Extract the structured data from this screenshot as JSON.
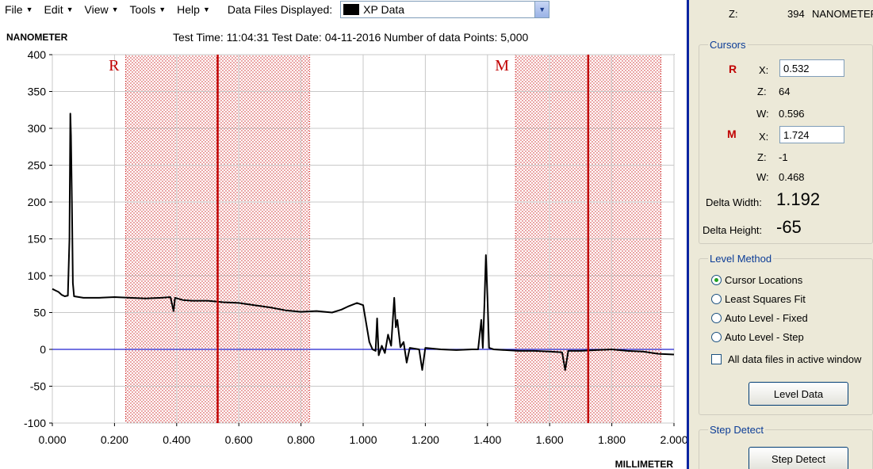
{
  "menu": {
    "items": [
      {
        "label": "File"
      },
      {
        "label": "Edit"
      },
      {
        "label": "View"
      },
      {
        "label": "Tools"
      },
      {
        "label": "Help"
      }
    ],
    "files_label": "Data Files Displayed:",
    "files_value": "XP Data"
  },
  "chart": {
    "y_unit": "NANOMETER",
    "x_unit": "MILLIMETER",
    "info": "Test Time: 11:04:31  Test Date: 04-11-2016  Number of data Points: 5,000"
  },
  "chart_data": {
    "type": "line",
    "x_range": [
      0,
      2.0
    ],
    "y_range": [
      -100,
      400
    ],
    "x_ticks": [
      {
        "value": 0.0,
        "label": "0.000"
      },
      {
        "value": 0.2,
        "label": "0.200"
      },
      {
        "value": 0.4,
        "label": "0.400"
      },
      {
        "value": 0.6,
        "label": "0.600"
      },
      {
        "value": 0.8,
        "label": "0.800"
      },
      {
        "value": 1.0,
        "label": "1.000"
      },
      {
        "value": 1.2,
        "label": "1.200"
      },
      {
        "value": 1.4,
        "label": "1.400"
      },
      {
        "value": 1.6,
        "label": "1.600"
      },
      {
        "value": 1.8,
        "label": "1.800"
      },
      {
        "value": 2.0,
        "label": "2.000"
      }
    ],
    "y_ticks": [
      {
        "value": 400,
        "label": "400"
      },
      {
        "value": 350,
        "label": "350"
      },
      {
        "value": 300,
        "label": "300"
      },
      {
        "value": 250,
        "label": "250"
      },
      {
        "value": 200,
        "label": "200"
      },
      {
        "value": 150,
        "label": "150"
      },
      {
        "value": 100,
        "label": "100"
      },
      {
        "value": 50,
        "label": "50"
      },
      {
        "value": 0,
        "label": "0"
      },
      {
        "value": -50,
        "label": "-50"
      },
      {
        "value": -100,
        "label": "-100"
      }
    ],
    "grid": true,
    "baseline": 0,
    "cursors": [
      {
        "label": "R",
        "x": 0.532,
        "band": [
          0.236,
          0.828
        ]
      },
      {
        "label": "M",
        "x": 1.724,
        "band": [
          1.49,
          1.958
        ]
      }
    ],
    "profile": [
      [
        0.0,
        82
      ],
      [
        0.01,
        80
      ],
      [
        0.02,
        78
      ],
      [
        0.03,
        74
      ],
      [
        0.04,
        72
      ],
      [
        0.05,
        73
      ],
      [
        0.055,
        150
      ],
      [
        0.058,
        320
      ],
      [
        0.06,
        290
      ],
      [
        0.063,
        200
      ],
      [
        0.066,
        90
      ],
      [
        0.07,
        72
      ],
      [
        0.1,
        70
      ],
      [
        0.15,
        70
      ],
      [
        0.2,
        71
      ],
      [
        0.25,
        70
      ],
      [
        0.3,
        69
      ],
      [
        0.35,
        70
      ],
      [
        0.38,
        71
      ],
      [
        0.39,
        52
      ],
      [
        0.395,
        70
      ],
      [
        0.42,
        67
      ],
      [
        0.45,
        66
      ],
      [
        0.5,
        66
      ],
      [
        0.55,
        64
      ],
      [
        0.6,
        63
      ],
      [
        0.65,
        60
      ],
      [
        0.7,
        57
      ],
      [
        0.75,
        53
      ],
      [
        0.8,
        51
      ],
      [
        0.85,
        52
      ],
      [
        0.9,
        50
      ],
      [
        0.93,
        54
      ],
      [
        0.95,
        58
      ],
      [
        0.98,
        63
      ],
      [
        1.0,
        60
      ],
      [
        1.01,
        35
      ],
      [
        1.02,
        10
      ],
      [
        1.03,
        0
      ],
      [
        1.04,
        -2
      ],
      [
        1.045,
        42
      ],
      [
        1.05,
        -8
      ],
      [
        1.06,
        5
      ],
      [
        1.07,
        -5
      ],
      [
        1.08,
        20
      ],
      [
        1.09,
        5
      ],
      [
        1.1,
        70
      ],
      [
        1.105,
        30
      ],
      [
        1.11,
        40
      ],
      [
        1.12,
        3
      ],
      [
        1.13,
        10
      ],
      [
        1.14,
        -18
      ],
      [
        1.15,
        2
      ],
      [
        1.18,
        0
      ],
      [
        1.19,
        -28
      ],
      [
        1.2,
        2
      ],
      [
        1.25,
        0
      ],
      [
        1.3,
        -1
      ],
      [
        1.35,
        0
      ],
      [
        1.37,
        0
      ],
      [
        1.38,
        40
      ],
      [
        1.385,
        2
      ],
      [
        1.39,
        60
      ],
      [
        1.395,
        128
      ],
      [
        1.4,
        70
      ],
      [
        1.405,
        2
      ],
      [
        1.42,
        0
      ],
      [
        1.5,
        -2
      ],
      [
        1.55,
        -2
      ],
      [
        1.6,
        -3
      ],
      [
        1.64,
        -4
      ],
      [
        1.65,
        -28
      ],
      [
        1.66,
        -2
      ],
      [
        1.7,
        -2
      ],
      [
        1.75,
        -1
      ],
      [
        1.8,
        0
      ],
      [
        1.85,
        -2
      ],
      [
        1.9,
        -3
      ],
      [
        1.95,
        -6
      ],
      [
        2.0,
        -7
      ]
    ]
  },
  "panel": {
    "top_z_label": "Z:",
    "top_z_value": "394",
    "top_z_unit": "NANOMETER",
    "cursors_title": "Cursors",
    "r_label": "R",
    "r_x_label": "X:",
    "r_x": "0.532",
    "r_z_label": "Z:",
    "r_z": "64",
    "r_w_label": "W:",
    "r_w": "0.596",
    "m_label": "M",
    "m_x_label": "X:",
    "m_x": "1.724",
    "m_z_label": "Z:",
    "m_z": "-1",
    "m_w_label": "W:",
    "m_w": "0.468",
    "delta_width_label": "Delta Width:",
    "delta_width": "1.192",
    "delta_height_label": "Delta Height:",
    "delta_height": "-65",
    "level_method_title": "Level Method",
    "level_options": [
      {
        "label": "Cursor Locations",
        "selected": true
      },
      {
        "label": "Least Squares Fit",
        "selected": false
      },
      {
        "label": "Auto Level - Fixed",
        "selected": false
      },
      {
        "label": "Auto Level - Step",
        "selected": false
      }
    ],
    "all_files_label": "All data files in active window",
    "level_button": "Level Data",
    "step_detect_title": "Step Detect",
    "step_button": "Step Detect"
  },
  "colors": {
    "cursor": "#c00000",
    "band_dot": "#cc2020",
    "baseline": "#2020d0",
    "trace": "#000000",
    "grid": "#c8c8c8",
    "divider": "#0a24a0"
  }
}
